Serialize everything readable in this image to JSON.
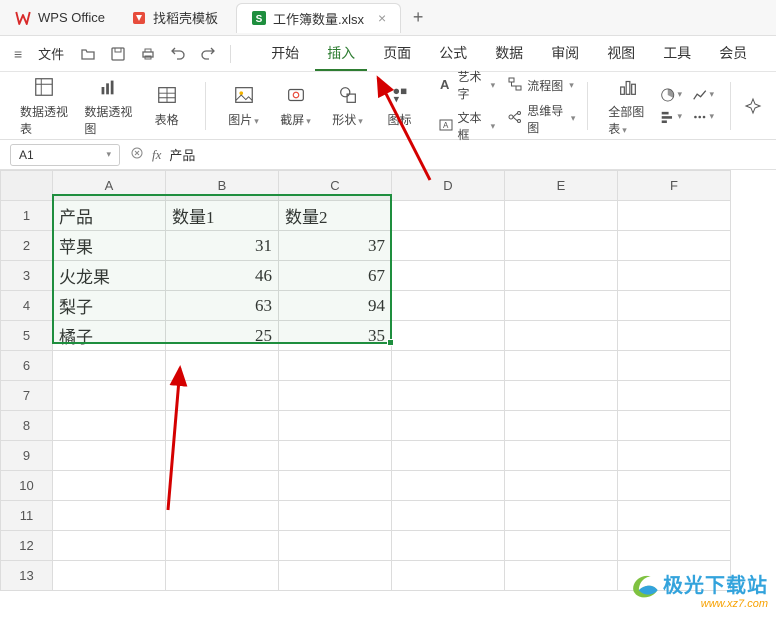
{
  "app_name": "WPS Office",
  "tabs": [
    {
      "label": "找稻壳模板"
    },
    {
      "label": "工作簿数量.xlsx"
    }
  ],
  "menu": {
    "file": "文件",
    "items": [
      "开始",
      "插入",
      "页面",
      "公式",
      "数据",
      "审阅",
      "视图",
      "工具",
      "会员"
    ]
  },
  "ribbon": {
    "pivot_table": "数据透视表",
    "pivot_chart": "数据透视图",
    "table": "表格",
    "picture": "图片",
    "screenshot": "截屏",
    "shapes": "形状",
    "icons": "图标",
    "wordart": "艺术字",
    "textbox": "文本框",
    "flowchart": "流程图",
    "mindmap": "思维导图",
    "all_charts": "全部图表"
  },
  "namebox": "A1",
  "formula": "产品",
  "columns": [
    "A",
    "B",
    "C",
    "D",
    "E",
    "F"
  ],
  "rows": [
    "1",
    "2",
    "3",
    "4",
    "5",
    "6",
    "7",
    "8",
    "9",
    "10",
    "11",
    "12",
    "13"
  ],
  "cells": {
    "A1": "产品",
    "B1": "数量1",
    "C1": "数量2",
    "A2": "苹果",
    "B2": "31",
    "C2": "37",
    "A3": "火龙果",
    "B3": "46",
    "C3": "67",
    "A4": "梨子",
    "B4": "63",
    "C4": "94",
    "A5": "橘子",
    "B5": "25",
    "C5": "35"
  },
  "watermark": {
    "text": "极光下载站",
    "url": "www.xz7.com"
  },
  "chart_data": {
    "type": "table",
    "title": "",
    "columns": [
      "产品",
      "数量1",
      "数量2"
    ],
    "rows": [
      {
        "产品": "苹果",
        "数量1": 31,
        "数量2": 37
      },
      {
        "产品": "火龙果",
        "数量1": 46,
        "数量2": 67
      },
      {
        "产品": "梨子",
        "数量1": 63,
        "数量2": 94
      },
      {
        "产品": "橘子",
        "数量1": 25,
        "数量2": 35
      }
    ]
  }
}
